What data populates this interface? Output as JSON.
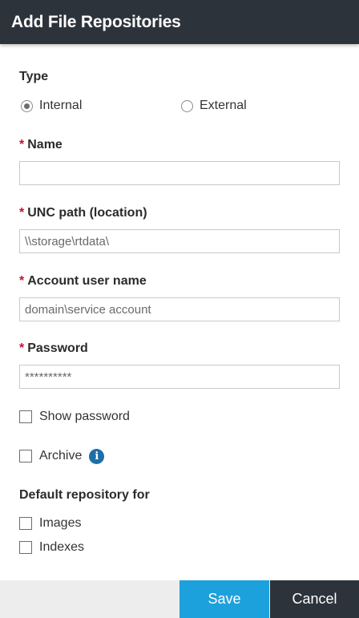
{
  "dialog": {
    "title": "Add File Repositories"
  },
  "type_section": {
    "label": "Type",
    "options": [
      {
        "label": "Internal",
        "checked": true
      },
      {
        "label": "External",
        "checked": false
      }
    ]
  },
  "required_mark": "*",
  "fields": {
    "name": {
      "label": "Name",
      "value": "",
      "placeholder": ""
    },
    "unc_path": {
      "label": "UNC path (location)",
      "placeholder": "\\\\storage\\rtdata\\"
    },
    "account_user": {
      "label": "Account user name",
      "placeholder": "domain\\service account"
    },
    "password": {
      "label": "Password",
      "placeholder": "**********"
    }
  },
  "show_password": {
    "label": "Show password",
    "checked": false
  },
  "archive": {
    "label": "Archive",
    "checked": false,
    "icon": "info-icon",
    "icon_glyph": "i"
  },
  "default_repo": {
    "label": "Default repository for",
    "options": [
      {
        "label": "Images",
        "checked": false
      },
      {
        "label": "Indexes",
        "checked": false
      }
    ]
  },
  "footer": {
    "save_label": "Save",
    "cancel_label": "Cancel"
  },
  "colors": {
    "header_bg": "#2d333b",
    "save_bg": "#1da1dc",
    "cancel_bg": "#2d333b",
    "required": "#c8102e",
    "info": "#1e6ea8"
  }
}
